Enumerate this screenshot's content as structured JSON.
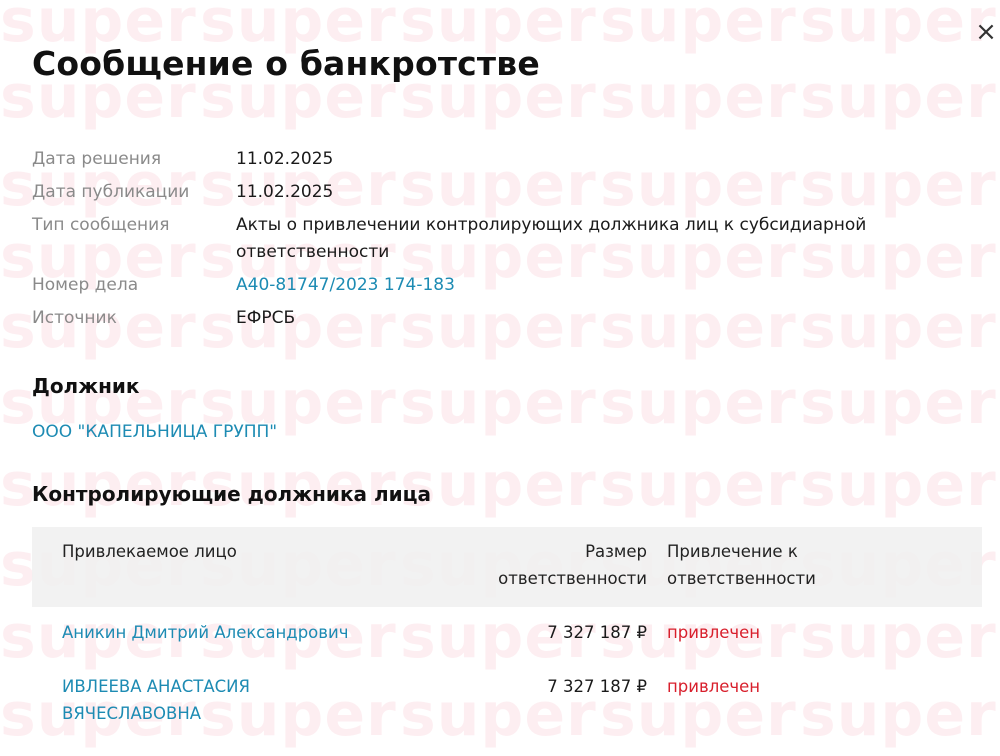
{
  "watermark": {
    "text": "super"
  },
  "close_icon": "×",
  "title": "Сообщение о банкротстве",
  "info": [
    {
      "label": "Дата решения",
      "value": "11.02.2025"
    },
    {
      "label": "Дата публикации",
      "value": "11.02.2025"
    },
    {
      "label": "Тип сообщения",
      "value": "Акты о привлечении контролирующих должника лиц к субсидиарной ответственности"
    },
    {
      "label": "Номер дела",
      "value": "А40-81747/2023 174-183"
    },
    {
      "label": "Источник",
      "value": "ЕФРСБ"
    }
  ],
  "debtor": {
    "heading": "Должник",
    "name": "ООО \"КАПЕЛЬНИЦА ГРУПП\""
  },
  "controlling": {
    "heading": "Контролирующие должника лица",
    "columns": {
      "person": "Привлекаемое лицо",
      "amount_line1": "Размер",
      "amount_line2": "ответственности",
      "status_line1": "Привлечение к",
      "status_line2": "ответственности"
    },
    "rows": [
      {
        "name_line1": "Аникин Дмитрий Александрович",
        "name_line2": "",
        "amount": "7 327 187 ₽",
        "status": "привлечен"
      },
      {
        "name_line1": "ИВЛЕЕВА АНАСТАСИЯ",
        "name_line2": "ВЯЧЕСЛАВОВНА",
        "amount": "7 327 187 ₽",
        "status": "привлечен"
      }
    ]
  },
  "colors": {
    "link": "#1d8bb3",
    "status": "#d81f2c",
    "label": "#8a8a8a"
  }
}
